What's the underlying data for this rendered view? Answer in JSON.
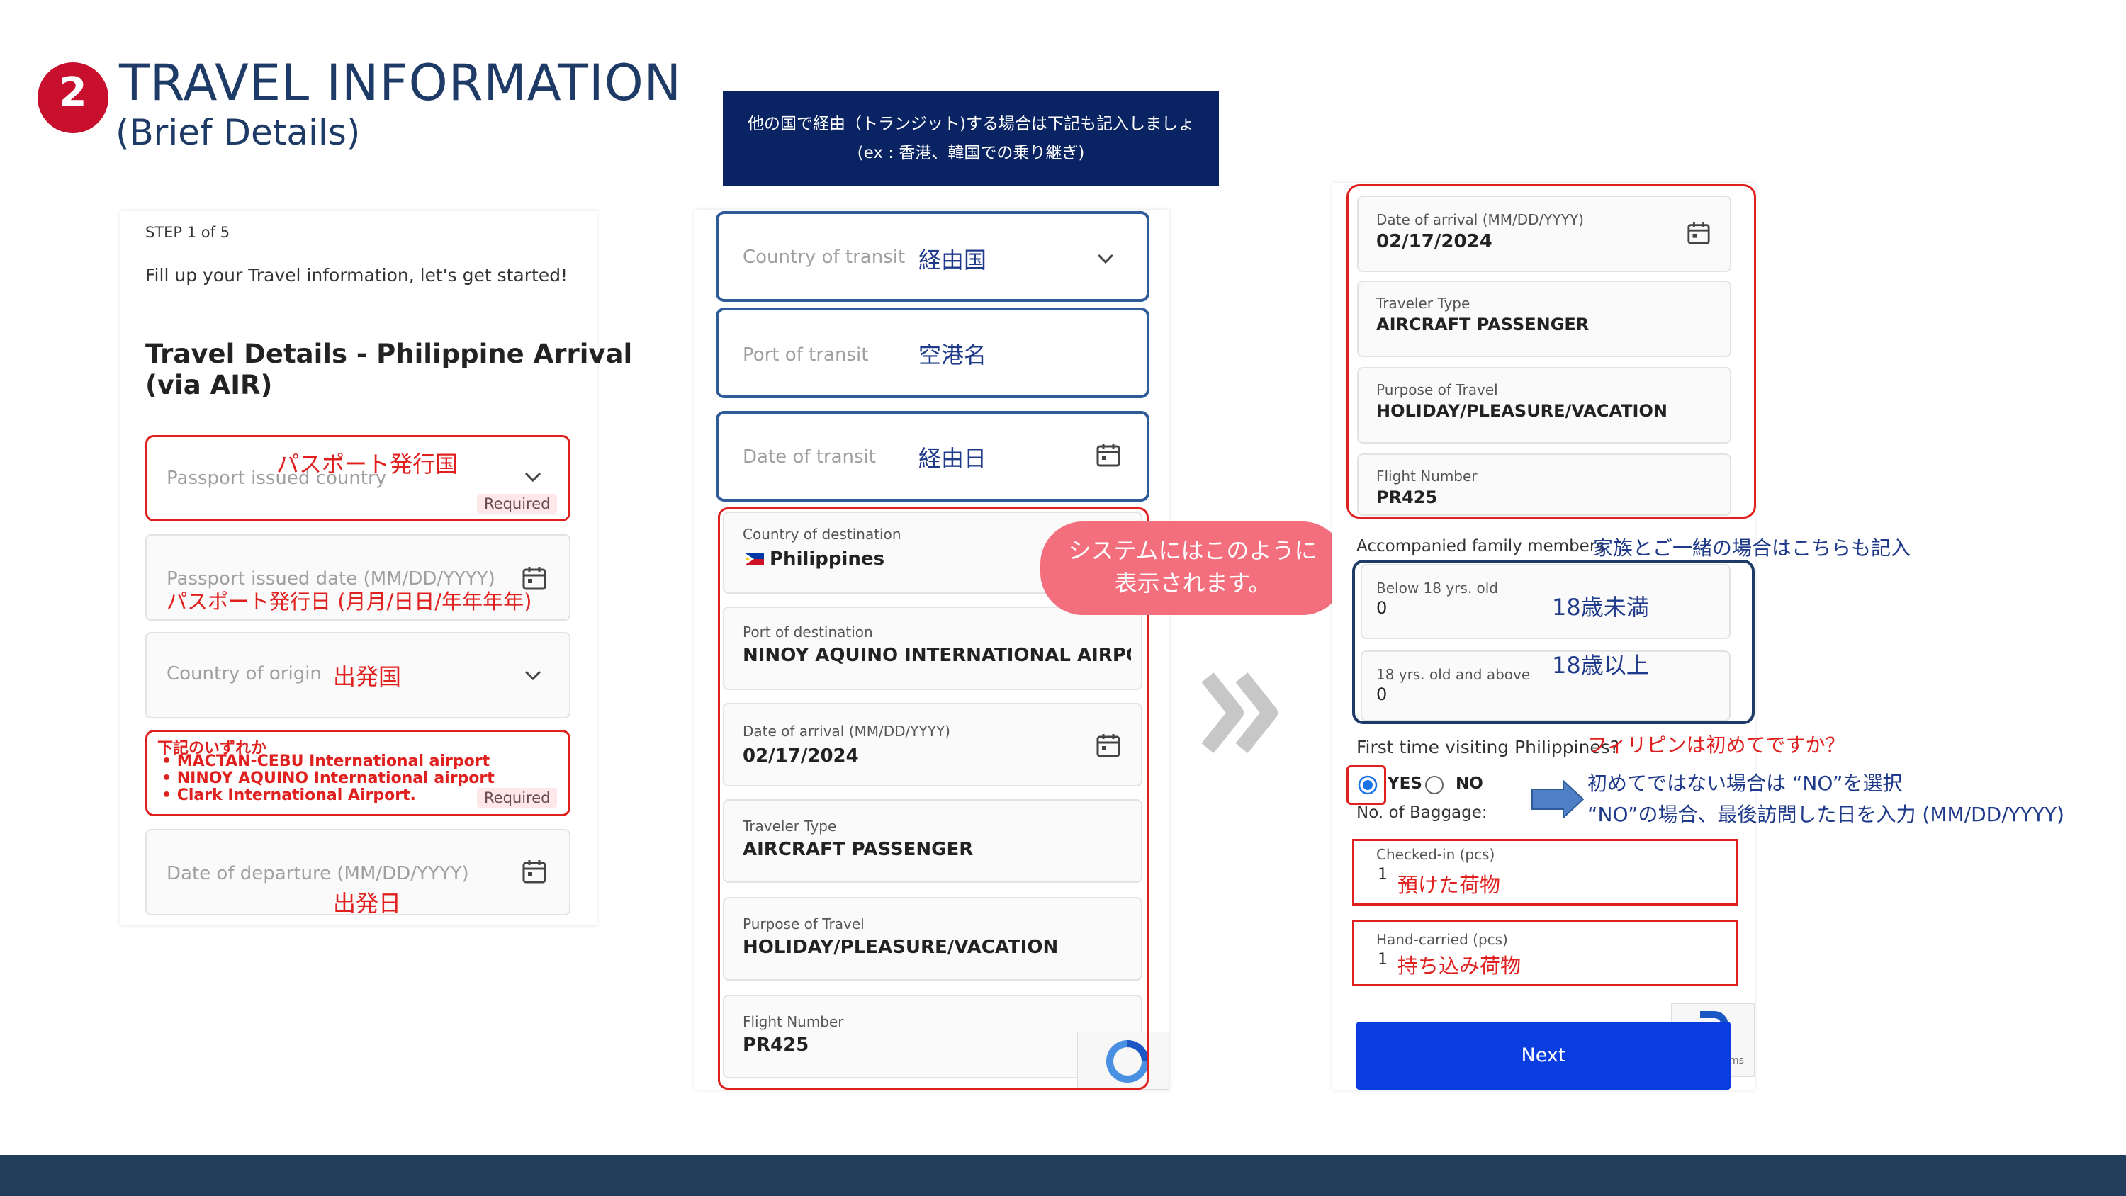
{
  "header": {
    "step_number": "2",
    "title": "TRAVEL INFORMATION",
    "subtitle": "(Brief Details)"
  },
  "transit_note": {
    "line1": "他の国で経由（トランジット)する場合は下記も記入しましょ",
    "line2": "(ex : 香港、韓国での乗り継ぎ)"
  },
  "panel1": {
    "step": "STEP 1 of 5",
    "intro": "Fill up your Travel information, let's get started!",
    "heading_line1": "Travel Details - Philippine Arrival",
    "heading_line2": "(via AIR)",
    "passport_country_placeholder": "Passport issued country",
    "passport_country_jp": "パスポート発行国",
    "required": "Required",
    "passport_date_placeholder": "Passport issued date (MM/DD/YYYY)",
    "passport_date_jp": "パスポート発行日 (月月/日日/年年年年)",
    "origin_placeholder": "Country of origin",
    "origin_jp": "出発国",
    "airport_note_title": "下記のいずれか",
    "airport_options": [
      "• MACTAN-CEBU International airport",
      "• NINOY AQUINO International airport",
      "• Clark International Airport."
    ],
    "departure_placeholder": "Date of departure (MM/DD/YYYY)",
    "departure_jp": "出発日"
  },
  "panel2": {
    "transit_country_placeholder": "Country of transit",
    "transit_country_jp": "経由国",
    "transit_port_placeholder": "Port of transit",
    "transit_port_jp": "空港名",
    "transit_date_placeholder": "Date of transit",
    "transit_date_jp": "経由日",
    "dest_country_label": "Country of destination",
    "dest_country_value": "Philippines",
    "dest_port_label": "Port of destination",
    "dest_port_value": "NINOY AQUINO INTERNATIONAL AIRPORT T",
    "arrival_label": "Date of arrival (MM/DD/YYYY)",
    "arrival_value": "02/17/2024",
    "traveler_label": "Traveler Type",
    "traveler_value": "AIRCRAFT PASSENGER",
    "purpose_label": "Purpose of Travel",
    "purpose_value": "HOLIDAY/PLEASURE/VACATION",
    "flight_label": "Flight Number",
    "flight_value": "PR425"
  },
  "callout": {
    "line1": "システムにはこのように",
    "line2": "表示されます。"
  },
  "panel3": {
    "arrival_label": "Date of arrival (MM/DD/YYYY)",
    "arrival_value": "02/17/2024",
    "traveler_label": "Traveler Type",
    "traveler_value": "AIRCRAFT PASSENGER",
    "purpose_label": "Purpose of Travel",
    "purpose_value": "HOLIDAY/PLEASURE/VACATION",
    "flight_label": "Flight Number",
    "flight_value": "PR425",
    "family_label": "Accompanied family members",
    "family_jp": "家族とご一緒の場合はこちらも記入",
    "below18_label": "Below 18 yrs. old",
    "below18_value": "0",
    "below18_jp": "18歳未満",
    "above18_label": "18 yrs. old and above",
    "above18_value": "0",
    "above18_jp": "18歳以上",
    "first_time_label": "First time visiting Philippines?",
    "first_time_jp": "フィリピンは初めてですか？",
    "yes": "YES",
    "no": "NO",
    "no_note_line1": "初めてではない場合は “NO”を選択",
    "no_note_line2": "“NO”の場合、最後訪問した日を入力 (MM/DD/YYYY)",
    "baggage_label": "No. of Baggage:",
    "checked_label": "Checked-in (pcs)",
    "checked_value": "1",
    "checked_jp": "預けた荷物",
    "hand_label": "Hand-carried (pcs)",
    "hand_value": "1",
    "hand_jp": "持ち込み荷物",
    "next": "Next",
    "recaptcha_text": "rms"
  },
  "colors": {
    "navy": "#1e3a66",
    "red": "#e0201e",
    "blue": "#2f5b9a",
    "pink": "#f46f7d",
    "next_button": "#0a3de0",
    "footer": "#213d5b"
  },
  "icons": [
    "chevron-down-icon",
    "calendar-icon",
    "double-chevron-right-icon",
    "right-arrow-icon",
    "philippines-flag-icon",
    "recaptcha-icon"
  ]
}
